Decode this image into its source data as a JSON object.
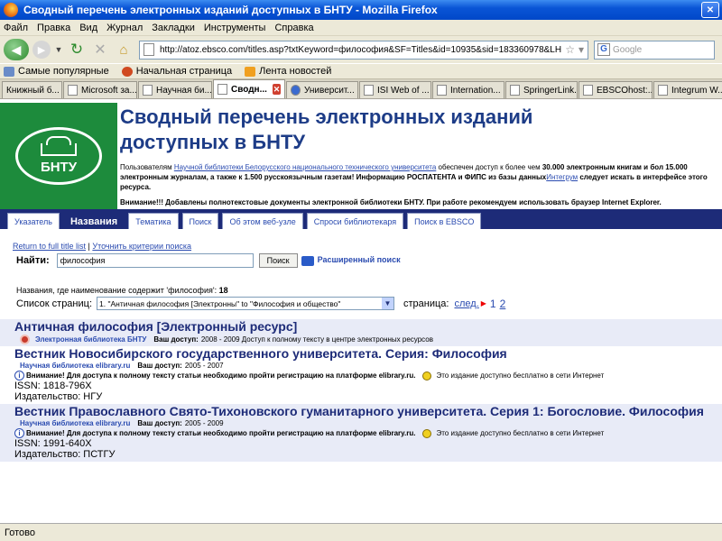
{
  "window": {
    "title": "Сводный перечень электронных изданий доступных в БНТУ - Mozilla Firefox"
  },
  "menu": [
    "Файл",
    "Правка",
    "Вид",
    "Журнал",
    "Закладки",
    "Инструменты",
    "Справка"
  ],
  "nav": {
    "url": "http://atoz.ebsco.com/titles.asp?txtKeyword=философия&SF=Titles&id=10935&sid=183360978&LH=&lang.su",
    "search_placeholder": "Google"
  },
  "bookmarks": [
    "Самые популярные",
    "Начальная страница",
    "Лента новостей"
  ],
  "tabs": [
    "Книжный б...",
    "Microsoft за...",
    "Научная би...",
    "Сводн...",
    "Университ...",
    "ISI Web of ...",
    "Internation...",
    "SpringerLink...",
    "EBSCOhost:...",
    "Integrum W..."
  ],
  "colors": {
    "brand_green": "#1d8b3c",
    "title_blue": "#1d3c87",
    "nav_blue": "#1d2b78",
    "link_blue": "#2a4bb0",
    "highlight_bg": "#e8ebf7"
  },
  "header": {
    "logo_text": "БНТУ",
    "title_line1": "Сводный перечень электронных изданий",
    "title_line2": "доступных в БНТУ",
    "intro_a": "Пользователям ",
    "intro_link": "Научной библиотеки Белорусского национального технического университета",
    "intro_b": " обеспечен доступ к более чем ",
    "intro_bold1": "30.000 электронным книгам и бол 15.000 электронным журналам, а также к 1.500 русскоязычным газетам! Информацию РОСПАТЕНТА и ФИПС из базы данных",
    "intro_link2": "Интегрум",
    "intro_bold2": " следует искать в интерфейсе этого ресурса.",
    "warning": "Внимание!!! Добавлены полнотекстовые документы электронной библиотеки БНТУ. При работе рекомендуем использовать браузер Internet Explorer."
  },
  "site_tabs": [
    "Указатель",
    "Названия",
    "Тематика",
    "Поиск",
    "Об этом веб-узле",
    "Спроси библиотекаря",
    "Поиск в EBSCO"
  ],
  "search": {
    "return_link": "Return to full title list",
    "refine_link": "Уточнить критерии поиска",
    "find_label": "Найти:",
    "query": "философия",
    "button": "Поиск",
    "advanced": "Расширенный поиск"
  },
  "results": {
    "count_label": "Названия, где наименование содержит 'философия':",
    "count": "18",
    "pages_label": "Список страниц:",
    "pages_select": "1. \"Античная философия [Электронны\" to \"Философия и общество\"",
    "page_label": "страница:",
    "next": "след.",
    "page1": "1",
    "page2": "2"
  },
  "records": [
    {
      "title": "Античная философия [Электронный ресурс]",
      "source": "Электронная библиотека БНТУ",
      "access_label": "Ваш доступ:",
      "access": "2008 - 2009  Доступ к полному тексту в центре электронных ресурсов"
    },
    {
      "title": "Вестник Новосибирского государственного университета. Серия: Философия",
      "source": "Научная библиотека elibrary.ru",
      "access_label": "Ваш доступ:",
      "access": "2005 - 2007",
      "note": "Внимание! Для доступа к полному тексту статьи необходимо пройти регистрацию на платформе elibrary.ru.",
      "free_note": "Это издание доступно бесплатно в сети Интернет",
      "issn": "ISSN: 1818-796X",
      "publisher": "Издательство: НГУ"
    },
    {
      "title": "Вестник Православного Свято-Тихоновского гуманитарного университета. Серия 1: Богословие. Философия",
      "source": "Научная библиотека elibrary.ru",
      "access_label": "Ваш доступ:",
      "access": "2005 - 2009",
      "note": "Внимание! Для доступа к полному тексту статьи необходимо пройти регистрацию на платформе elibrary.ru.",
      "free_note": "Это издание доступно бесплатно в сети Интернет",
      "issn": "ISSN: 1991-640X",
      "publisher": "Издательство: ПСТГУ"
    }
  ],
  "status": "Готово"
}
